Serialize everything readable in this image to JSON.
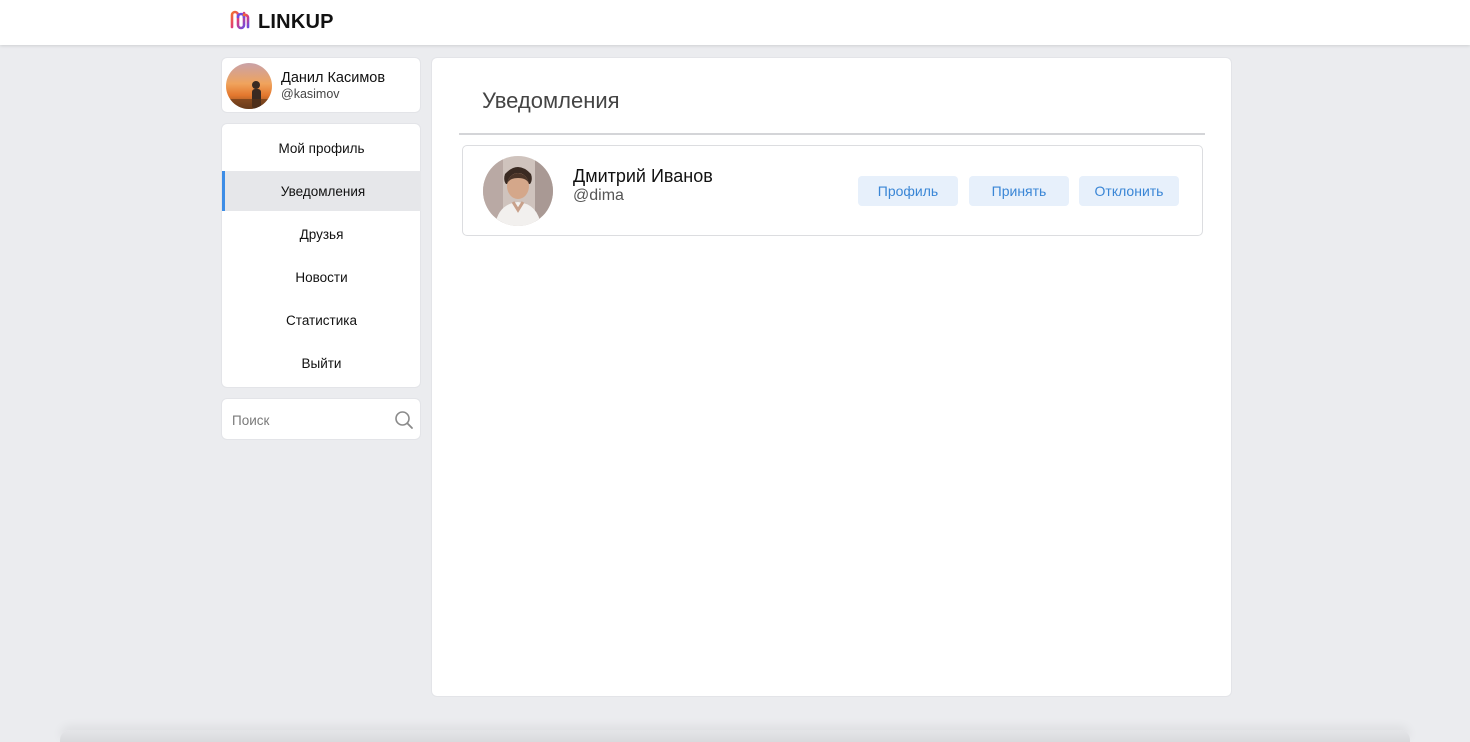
{
  "header": {
    "logo_text": "LINKUP",
    "logo_icon": "linkup-logo-icon"
  },
  "user": {
    "name": "Данил Касимов",
    "handle": "@kasimov",
    "avatar_icon": "user-avatar-sunset"
  },
  "sidebar": {
    "items": [
      {
        "label": "Мой профиль",
        "active": false
      },
      {
        "label": "Уведомления",
        "active": true
      },
      {
        "label": "Друзья",
        "active": false
      },
      {
        "label": "Новости",
        "active": false
      },
      {
        "label": "Статистика",
        "active": false
      },
      {
        "label": "Выйти",
        "active": false
      }
    ],
    "active_color": "#3d8de6"
  },
  "search": {
    "placeholder": "Поиск",
    "value": "",
    "icon": "search-icon"
  },
  "main": {
    "title": "Уведомления",
    "notifications": [
      {
        "name": "Дмитрий Иванов",
        "handle": "@dima",
        "buttons": {
          "profile": "Профиль",
          "accept": "Принять",
          "decline": "Отклонить"
        }
      }
    ]
  },
  "colors": {
    "background": "#ebecef",
    "button_bg": "#e7f0fb",
    "button_text": "#3a86d6"
  }
}
